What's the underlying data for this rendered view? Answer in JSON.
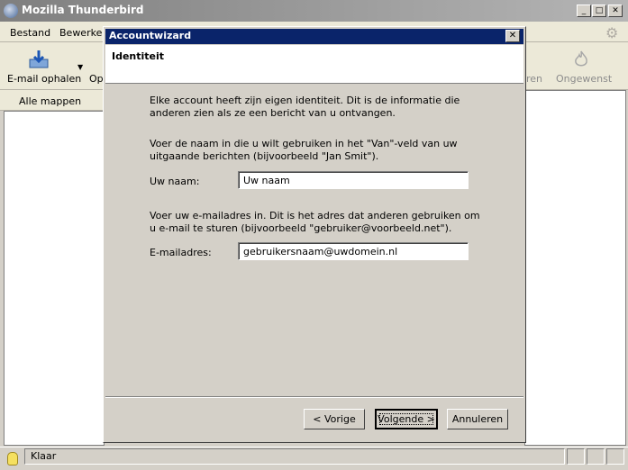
{
  "window": {
    "title": "Mozilla Thunderbird"
  },
  "menubar": {
    "items": [
      "Bestand",
      "Bewerken"
    ]
  },
  "toolbar": {
    "get_mail": "E-mail ophalen",
    "partial_left": "Op",
    "partial_right": "ren",
    "junk": "Ongewenst"
  },
  "folders": {
    "header": "Alle mappen"
  },
  "status": {
    "text": "Klaar"
  },
  "dialog": {
    "title": "Accountwizard",
    "close": "✕",
    "header": "Identiteit",
    "intro": "Elke account heeft zijn eigen identiteit. Dit is de informatie die anderen zien als ze een bericht van u ontvangen.",
    "name_help": "Voer de naam in die u wilt gebruiken in het \"Van\"-veld van uw uitgaande berichten (bijvoorbeeld \"Jan Smit\").",
    "name_label": "Uw naam:",
    "name_value": "Uw naam",
    "email_help": "Voer uw e-mailadres in. Dit is het adres dat anderen gebruiken om u e-mail te sturen (bijvoorbeeld \"gebruiker@voorbeeld.net\").",
    "email_label": "E-mailadres:",
    "email_value": "gebruikersnaam@uwdomein.nl",
    "back": "< Vorige",
    "next": "Volgende >",
    "cancel": "Annuleren"
  }
}
